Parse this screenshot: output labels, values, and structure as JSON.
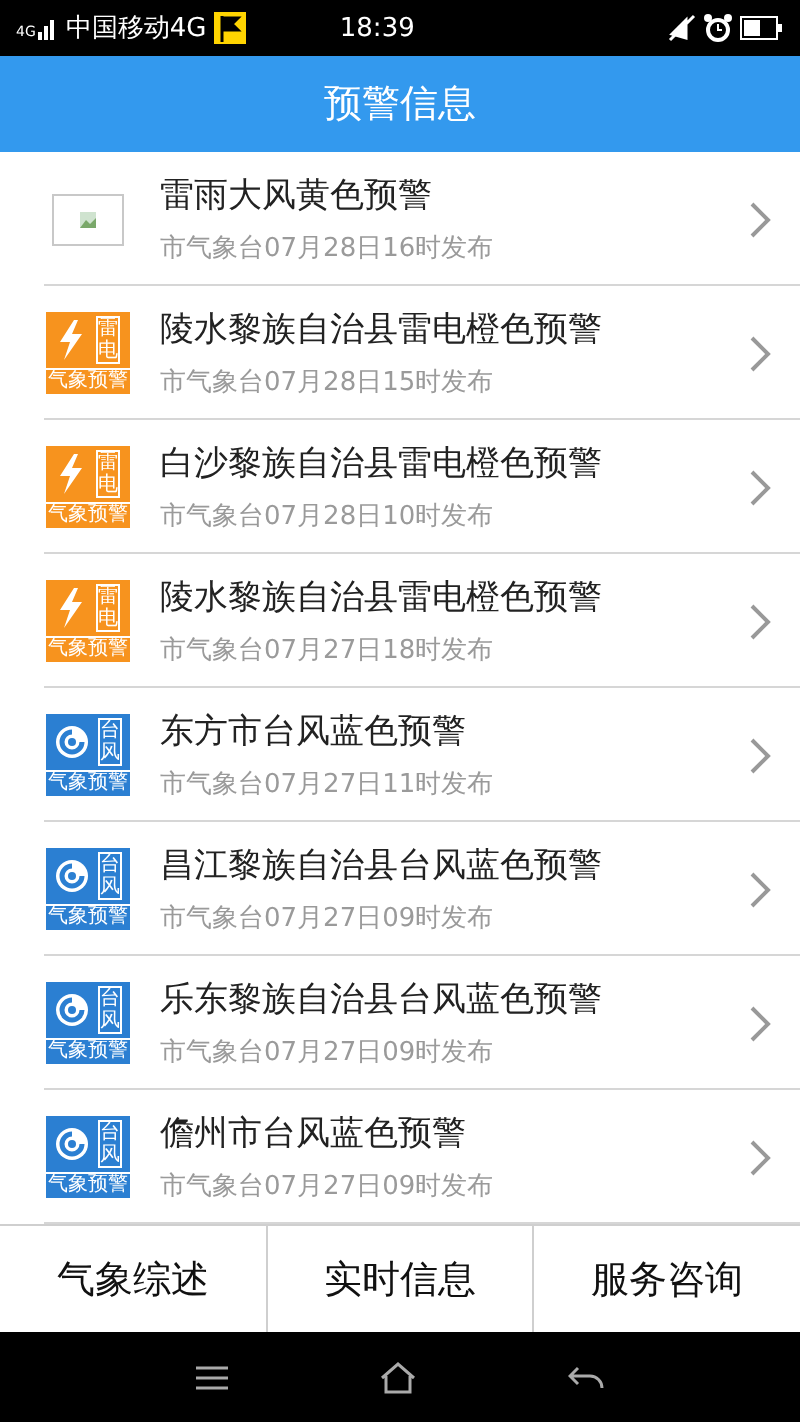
{
  "status_bar": {
    "signal_label": "4G",
    "carrier": "中国移动4G",
    "time": "18:39"
  },
  "header": {
    "title": "预警信息"
  },
  "alerts": [
    {
      "kind": "broken-image",
      "title": "雷雨大风黄色预警",
      "subtitle": "市气象台07月28日16时发布"
    },
    {
      "kind": "lightning",
      "badge": "雷电",
      "badge_footer": "气象预警",
      "title": "陵水黎族自治县雷电橙色预警",
      "subtitle": "市气象台07月28日15时发布"
    },
    {
      "kind": "lightning",
      "badge": "雷电",
      "badge_footer": "气象预警",
      "title": "白沙黎族自治县雷电橙色预警",
      "subtitle": "市气象台07月28日10时发布"
    },
    {
      "kind": "lightning",
      "badge": "雷电",
      "badge_footer": "气象预警",
      "title": "陵水黎族自治县雷电橙色预警",
      "subtitle": "市气象台07月27日18时发布"
    },
    {
      "kind": "typhoon",
      "badge": "台风",
      "badge_footer": "气象预警",
      "title": "东方市台风蓝色预警",
      "subtitle": "市气象台07月27日11时发布"
    },
    {
      "kind": "typhoon",
      "badge": "台风",
      "badge_footer": "气象预警",
      "title": "昌江黎族自治县台风蓝色预警",
      "subtitle": "市气象台07月27日09时发布"
    },
    {
      "kind": "typhoon",
      "badge": "台风",
      "badge_footer": "气象预警",
      "title": "乐东黎族自治县台风蓝色预警",
      "subtitle": "市气象台07月27日09时发布"
    },
    {
      "kind": "typhoon",
      "badge": "台风",
      "badge_footer": "气象预警",
      "title": "儋州市台风蓝色预警",
      "subtitle": "市气象台07月27日09时发布"
    }
  ],
  "bottom_tabs": [
    {
      "label": "气象综述"
    },
    {
      "label": "实时信息"
    },
    {
      "label": "服务咨询"
    }
  ]
}
